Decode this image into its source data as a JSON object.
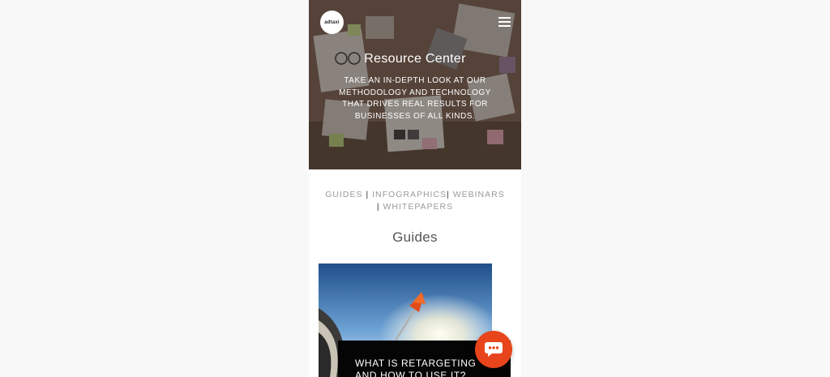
{
  "header": {
    "logo_text": "adtaxi",
    "menu_icon": "hamburger-menu-icon"
  },
  "hero": {
    "title": "Resource Center",
    "subtitle": "TAKE AN IN-DEPTH LOOK AT OUR METHODOLOGY AND TECHNOLOGY THAT DRIVES REAL RESULTS FOR BUSINESSES OF ALL KINDS."
  },
  "categories": {
    "guides": "GUIDES",
    "infographics": "INFOGRAPHICS",
    "webinars": "WEBINARS",
    "whitepapers": "WHITEPAPERS",
    "separator": "|"
  },
  "section": {
    "title": "Guides"
  },
  "card": {
    "caption_line1": "WHAT IS RETARGETING",
    "caption_line2": "AND HOW TO USE IT?"
  },
  "chat": {
    "icon": "chat-bubble-icon"
  },
  "colors": {
    "accent": "#e8451c",
    "page_bg": "#f8f8f8",
    "nav_text": "#9a9a9a"
  }
}
